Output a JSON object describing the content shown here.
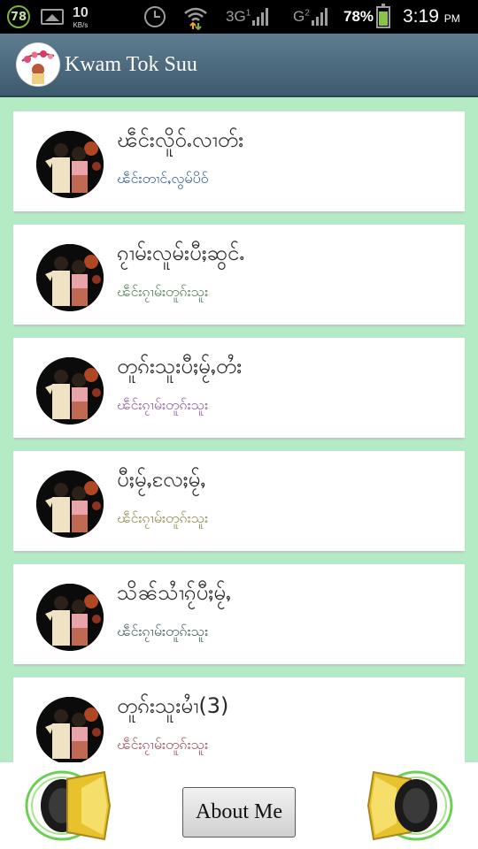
{
  "status_bar": {
    "badge": "78",
    "speed_value": "10",
    "speed_unit": "KB/s",
    "network_3g": "3G",
    "network_3g_sup": "1",
    "network_g": "G",
    "network_g_sup": "2",
    "battery_percent": "78%",
    "battery_level": 0.78,
    "time": "3:19",
    "ampm": "PM"
  },
  "app_bar": {
    "title": "Kwam Tok Suu",
    "logo_icon": "flower-logo-icon"
  },
  "songs": [
    {
      "title": "ၽဵင်းလိူဝ်ႉလၢတ်း",
      "artist": "ၽဵင်းတၢင်ႇလွမ်ပိဝ်",
      "artist_color": "#2f5a8a"
    },
    {
      "title": "ၵႂၢမ်းလူမ်းပီႈဆွင်ႉ",
      "artist": "ၽဵင်းၵႂၢမ်းတူၵ်းသူး",
      "artist_color": "#4f7a52"
    },
    {
      "title": "တူၵ်းသူးပီႈမႂ်ႇတႆး",
      "artist": "ၽဵင်းၵႂၢမ်းတူၵ်းသူး",
      "artist_color": "#8a5a9a"
    },
    {
      "title": "ပီႈမႂ်ႇလႄႈမႂ်ႇ",
      "artist": "ၽဵင်းၵႂၢမ်းတူၵ်းသူး",
      "artist_color": "#8e8a47"
    },
    {
      "title": "သိၼ်သၢႆၵႂ်ပီႈမႂ်ႇ",
      "artist": "ၽဵင်းၵႂၢမ်းတူၵ်းသူး",
      "artist_color": "#3f5a5a"
    },
    {
      "title": "တူၵ်းသူးမၢႆ(3)",
      "artist": "ၽဵင်းၵႂၢမ်းတူၵ်းသူး",
      "artist_color": "#9a4a5a"
    }
  ],
  "bottom_bar": {
    "about_label": "About Me",
    "left_icon": "speaker-icon",
    "right_icon": "speaker-icon"
  }
}
